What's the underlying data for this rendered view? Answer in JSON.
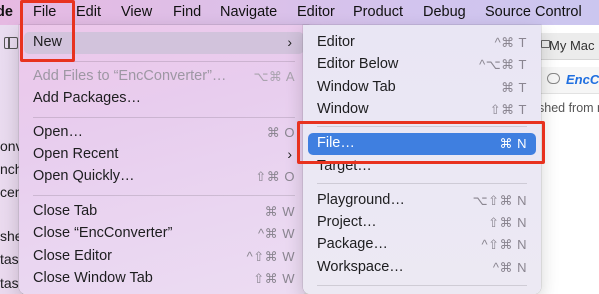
{
  "menubar": {
    "app_fragment": "de",
    "items": [
      "File",
      "Edit",
      "View",
      "Find",
      "Navigate",
      "Editor",
      "Product",
      "Debug",
      "Source Control"
    ]
  },
  "background": {
    "left_fragments": [
      "onv",
      "nch",
      "cen",
      "she",
      "tas",
      "tas"
    ],
    "tab_label": "My Mac",
    "doc_label": "EncCo",
    "status_fragment": "shed from m"
  },
  "file_menu": {
    "items": [
      {
        "label": "New",
        "shortcut": "",
        "submenu": true,
        "state": "hover"
      },
      {
        "label": "Add Files to “EncConverter”…",
        "shortcut": "⌥⌘ A",
        "state": "disabled"
      },
      {
        "label": "Add Packages…",
        "shortcut": ""
      },
      {
        "label": "Open…",
        "shortcut": "⌘ O"
      },
      {
        "label": "Open Recent",
        "shortcut": "",
        "submenu": true
      },
      {
        "label": "Open Quickly…",
        "shortcut": "⇧⌘ O"
      },
      {
        "label": "Close Tab",
        "shortcut": "⌘ W"
      },
      {
        "label": "Close “EncConverter”",
        "shortcut": "^⌘ W"
      },
      {
        "label": "Close Editor",
        "shortcut": "^⇧⌘ W"
      },
      {
        "label": "Close Window Tab",
        "shortcut": "⇧⌘ W"
      }
    ]
  },
  "new_submenu": {
    "items": [
      {
        "label": "Editor",
        "shortcut": "^⌘ T"
      },
      {
        "label": "Editor Below",
        "shortcut": "^⌥⌘ T"
      },
      {
        "label": "Window Tab",
        "shortcut": "⌘ T"
      },
      {
        "label": "Window",
        "shortcut": "⇧⌘ T"
      },
      {
        "label": "File…",
        "shortcut": "⌘ N",
        "state": "selected"
      },
      {
        "label": "Target…",
        "shortcut": ""
      },
      {
        "label": "Playground…",
        "shortcut": "⌥⇧⌘ N"
      },
      {
        "label": "Project…",
        "shortcut": "⇧⌘ N"
      },
      {
        "label": "Package…",
        "shortcut": "^⇧⌘ N"
      },
      {
        "label": "Workspace…",
        "shortcut": "^⌘ N"
      }
    ]
  },
  "colors": {
    "highlight_annotation": "#e8321f",
    "selected_item": "#3f7fe0",
    "link_text": "#1f6fe0"
  }
}
